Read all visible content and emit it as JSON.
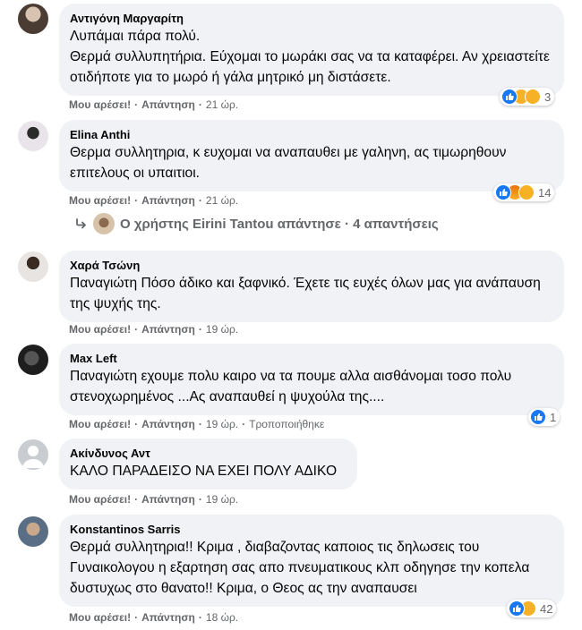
{
  "comments": [
    {
      "author": "Αντιγόνη Μαργαρίτη",
      "lines": [
        "Λυπάμαι πάρα πολύ.",
        "Θερμά συλλυπητήρια. Εύχομαι το μωράκι σας να τα καταφέρει. Αν χρειαστείτε οτιδήποτε για το μωρό ή γάλα μητρικό μη διστάσετε."
      ],
      "like": "Μου αρέσει!",
      "reply": "Απάντηση",
      "time": "21 ώρ.",
      "reaction_count": "3"
    },
    {
      "author": "Elina Anthi",
      "lines": [
        "Θερμα συλλητηρια, κ ευχομαι να αναπαυθει με γαληνη, ας τιμωρηθουν επιτελους οι υπαιτιοι."
      ],
      "like": "Μου αρέσει!",
      "reply": "Απάντηση",
      "time": "21 ώρ.",
      "reaction_count": "14",
      "replies_summary": "Ο χρήστης Eirini Tantou απάντησε · 4 απαντήσεις"
    },
    {
      "author": "Χαρά Τσώνη",
      "lines": [
        "Παναγιώτη Πόσο άδικο και ξαφνικό. Έχετε τις ευχές όλων μας για ανάπαυση της ψυχής της."
      ],
      "like": "Μου αρέσει!",
      "reply": "Απάντηση",
      "time": "19 ώρ."
    },
    {
      "author": "Max Left",
      "lines": [
        "Παναγιώτη εχουμε πολυ καιρο να τα πουμε αλλα αισθάνομαι τοσο πολυ στενοχωρημένος ...Ας αναπαυθεί η ψυχούλα της...."
      ],
      "like": "Μου αρέσει!",
      "reply": "Απάντηση",
      "time": "19 ώρ.",
      "edited": "Τροποποιήθηκε",
      "reaction_count": "1"
    },
    {
      "author": "Ακίνδυνος Αντ",
      "lines": [
        "ΚΑΛΟ ΠΑΡΑΔΕΙΣΟ ΝΑ ΕΧΕΙ ΠΟΛΥ ΑΔΙΚΟ"
      ],
      "like": "Μου αρέσει!",
      "reply": "Απάντηση",
      "time": "19 ώρ."
    },
    {
      "author": "Konstantinos Sarris",
      "lines": [
        "Θερμά συλλητηρια!! Κριμα , διαβαζοντας καποιος τις δηλωσεις του Γυναικολογου η εξαρτηση σας απο πνευματικους κλπ οδηγησε την κοπελα δυστυχως στο θανατο!! Κριμα, ο Θεος ας την αναπαυσει"
      ],
      "like": "Μου αρέσει!",
      "reply": "Απάντηση",
      "time": "18 ώρ.",
      "reaction_count": "42"
    }
  ],
  "colors": {
    "bubble": "#f0f2f5",
    "meta": "#65676b",
    "like_blue": "#1877f2",
    "emoji_yellow": "#f7b125"
  },
  "icons": [
    "like-icon",
    "haha-icon",
    "sad-icon",
    "angry-icon",
    "reply-arrow-icon"
  ]
}
